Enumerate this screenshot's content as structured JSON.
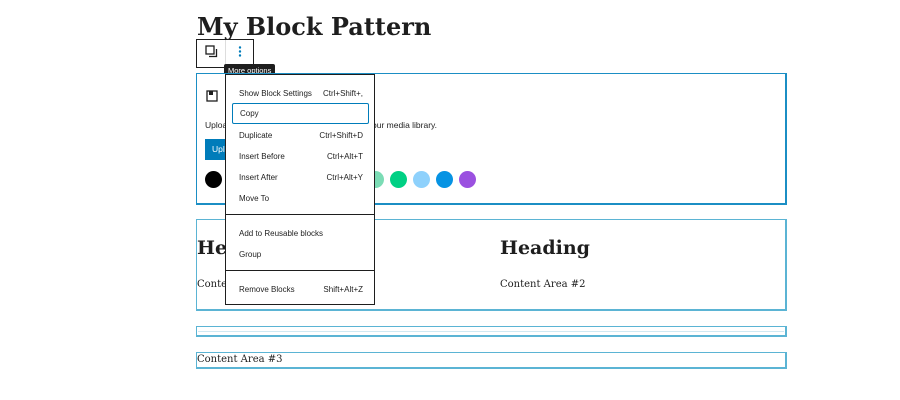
{
  "page": {
    "title": "My Block Pattern"
  },
  "toolbar": {
    "more_options_tooltip": "More options"
  },
  "image_block": {
    "description_start": "Uploa",
    "description_end": "our media library.",
    "upload_label": "Upl",
    "swatches": [
      "#000000",
      "#7bdcb5",
      "#00d084",
      "#8ed1fc",
      "#0693e3",
      "#9b51e0"
    ]
  },
  "columns": [
    {
      "heading": "Hea",
      "text": "Conte"
    },
    {
      "heading": "Heading",
      "text": "Content Area #2"
    }
  ],
  "paragraph": {
    "text": "Content Area #3"
  },
  "menu": {
    "items": [
      {
        "label": "Show Block Settings",
        "shortcut": "Ctrl+Shift+,"
      },
      {
        "label": "Copy",
        "shortcut": ""
      },
      {
        "label": "Duplicate",
        "shortcut": "Ctrl+Shift+D"
      },
      {
        "label": "Insert Before",
        "shortcut": "Ctrl+Alt+T"
      },
      {
        "label": "Insert After",
        "shortcut": "Ctrl+Alt+Y"
      },
      {
        "label": "Move To",
        "shortcut": ""
      },
      {
        "label": "Add to Reusable blocks",
        "shortcut": ""
      },
      {
        "label": "Group",
        "shortcut": ""
      },
      {
        "label": "Remove Blocks",
        "shortcut": "Shift+Alt+Z"
      }
    ]
  }
}
